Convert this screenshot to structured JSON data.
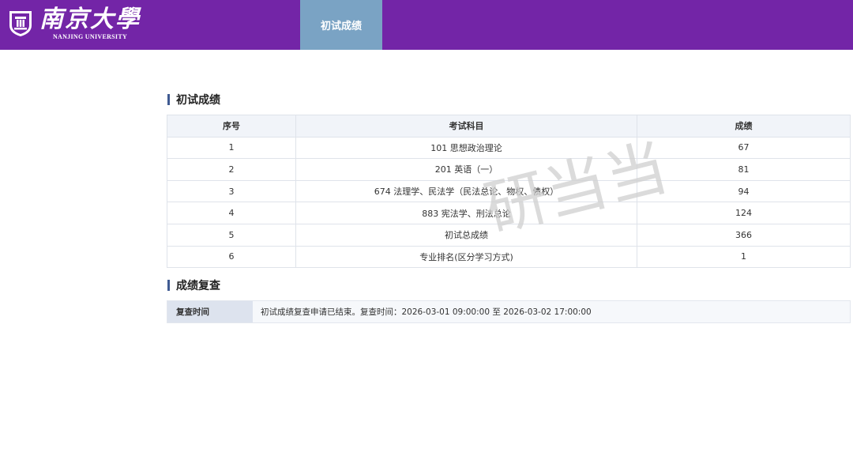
{
  "header": {
    "logo_cn": "南京大學",
    "logo_en": "NANJING UNIVERSITY",
    "nav_tab": "初试成绩"
  },
  "scores_section": {
    "title": "初试成绩",
    "columns": [
      "序号",
      "考试科目",
      "成绩"
    ],
    "rows": [
      {
        "index": "1",
        "subject": "101 思想政治理论",
        "score": "67"
      },
      {
        "index": "2",
        "subject": "201 英语（一）",
        "score": "81"
      },
      {
        "index": "3",
        "subject": "674 法理学、民法学（民法总论、物权、债权）",
        "score": "94"
      },
      {
        "index": "4",
        "subject": "883 宪法学、刑法总论",
        "score": "124"
      },
      {
        "index": "5",
        "subject": "初试总成绩",
        "score": "366"
      },
      {
        "index": "6",
        "subject": "专业排名(区分学习方式)",
        "score": "1"
      }
    ]
  },
  "review_section": {
    "title": "成绩复查",
    "label": "复查时间",
    "value": "初试成绩复查申请已结束。复查时间：2026-03-01 09:00:00 至 2026-03-02 17:00:00"
  },
  "watermark": {
    "text": "研当当",
    "color": "#cfcfcf"
  },
  "colors": {
    "topbar": "#7325a7",
    "nav_tab": "#7aa3c4",
    "accent_bar": "#3f5a92"
  }
}
